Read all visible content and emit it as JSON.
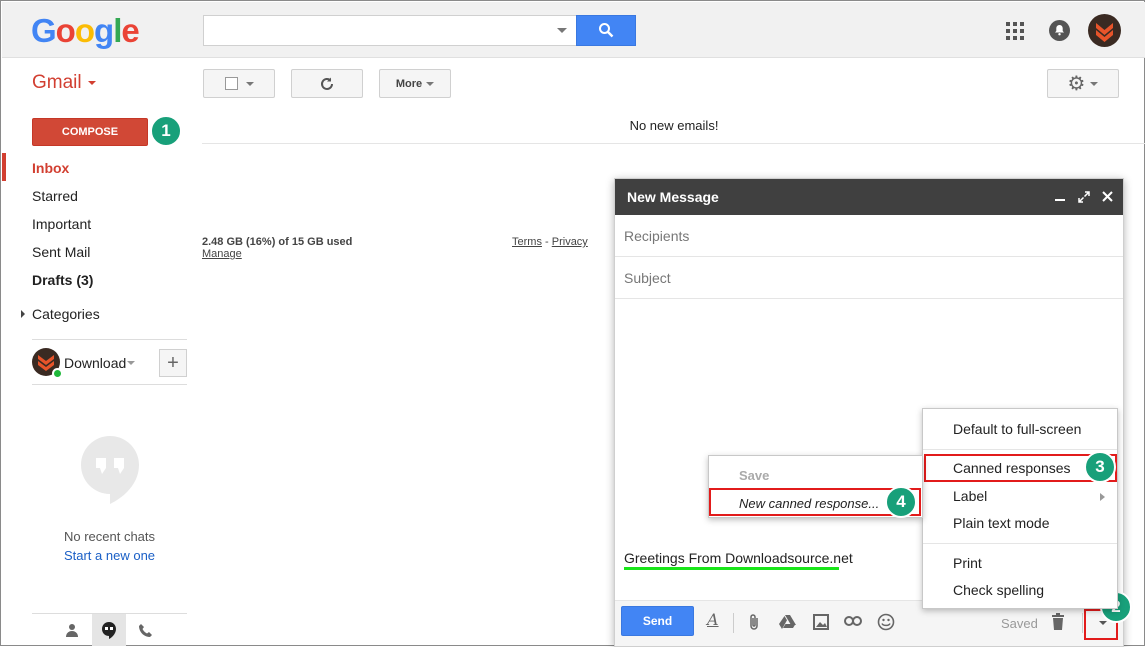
{
  "header": {
    "logo_letters": [
      "G",
      "o",
      "o",
      "g",
      "l",
      "e"
    ],
    "search_value": "",
    "colors": {
      "search_button": "#4285f4",
      "brand_red": "#d23f31",
      "badge_green": "#18a07a",
      "highlight_red": "#e21b1b",
      "underline_green": "#19e619"
    }
  },
  "toolbar": {
    "app_name": "Gmail",
    "more_label": "More",
    "status": "No new emails!"
  },
  "sidebar": {
    "compose_label": "COMPOSE",
    "items": [
      {
        "label": "Inbox"
      },
      {
        "label": "Starred"
      },
      {
        "label": "Important"
      },
      {
        "label": "Sent Mail"
      },
      {
        "label": "Drafts (3)"
      },
      {
        "label": "Categories"
      }
    ],
    "hangouts_user": "Download",
    "no_chats": "No recent chats",
    "start_new": "Start a new one"
  },
  "storage": {
    "usage": "2.48 GB (16%) of 15 GB used",
    "manage": "Manage",
    "terms": "Terms",
    "separator": "-",
    "privacy": "Privacy"
  },
  "compose": {
    "title": "New Message",
    "recipients_placeholder": "Recipients",
    "subject_placeholder": "Subject",
    "body": "Greetings From Downloadsource.net",
    "send_label": "Send",
    "saved_label": "Saved"
  },
  "more_menu": {
    "items": [
      "Default to full-screen",
      "Canned responses",
      "Label",
      "Plain text mode",
      "Print",
      "Check spelling"
    ]
  },
  "canned_menu": {
    "save_label": "Save",
    "new_label": "New canned response..."
  },
  "badges": [
    "1",
    "2",
    "3",
    "4"
  ]
}
